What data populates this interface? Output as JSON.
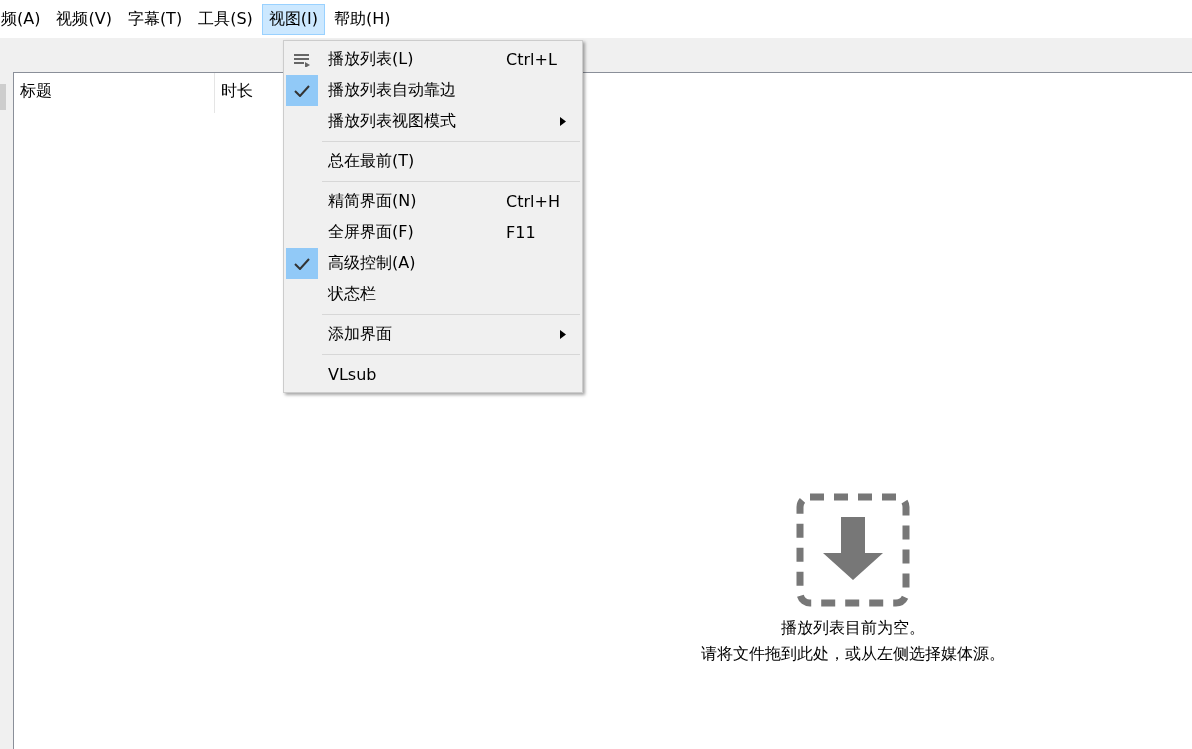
{
  "menubar": [
    {
      "label": "频(A)",
      "selected": false
    },
    {
      "label": "视频(V)",
      "selected": false
    },
    {
      "label": "字幕(T)",
      "selected": false
    },
    {
      "label": "工具(S)",
      "selected": false
    },
    {
      "label": "视图(I)",
      "selected": true
    },
    {
      "label": "帮助(H)",
      "selected": false
    }
  ],
  "playlist": {
    "columns": [
      "标题",
      "时长"
    ]
  },
  "view_menu": [
    {
      "kind": "icon-item",
      "label": "播放列表(L)",
      "shortcut": "Ctrl+L",
      "checked": false,
      "submenu": false
    },
    {
      "kind": "item",
      "label": "播放列表自动靠边",
      "checked": true,
      "submenu": false
    },
    {
      "kind": "item",
      "label": "播放列表视图模式",
      "checked": false,
      "submenu": true
    },
    {
      "kind": "separator"
    },
    {
      "kind": "item",
      "label": "总在最前(T)",
      "checked": false,
      "submenu": false
    },
    {
      "kind": "separator"
    },
    {
      "kind": "item",
      "label": "精简界面(N)",
      "shortcut": "Ctrl+H",
      "checked": false,
      "submenu": false
    },
    {
      "kind": "item",
      "label": "全屏界面(F)",
      "shortcut": "F11",
      "checked": false,
      "submenu": false
    },
    {
      "kind": "item",
      "label": "高级控制(A)",
      "checked": true,
      "submenu": false
    },
    {
      "kind": "item",
      "label": "状态栏",
      "checked": false,
      "submenu": false
    },
    {
      "kind": "separator"
    },
    {
      "kind": "item",
      "label": "添加界面",
      "checked": false,
      "submenu": true
    },
    {
      "kind": "separator"
    },
    {
      "kind": "item",
      "label": "VLsub",
      "checked": false,
      "submenu": false
    }
  ],
  "empty_state": {
    "lines": [
      "播放列表目前为空。",
      "请将文件拖到此处，或从左侧选择媒体源。"
    ]
  }
}
